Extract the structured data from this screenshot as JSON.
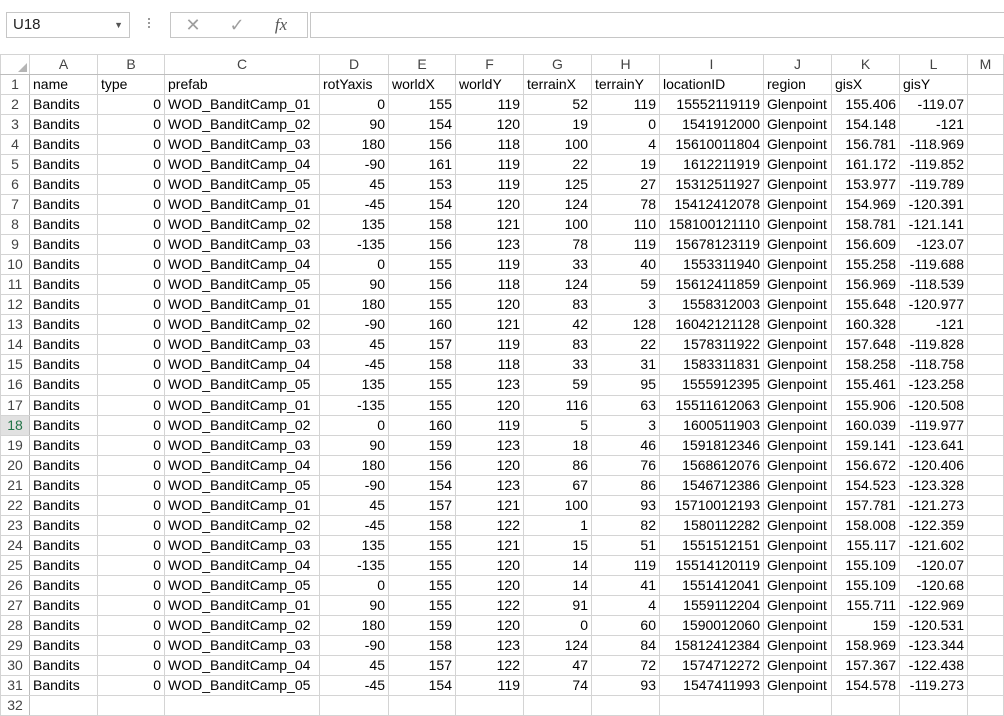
{
  "namebox": {
    "value": "U18"
  },
  "formula_bar": {
    "cancel_icon": "✕",
    "enter_icon": "✓",
    "fx_label": "fx",
    "value": ""
  },
  "columns": [
    "A",
    "B",
    "C",
    "D",
    "E",
    "F",
    "G",
    "H",
    "I",
    "J",
    "K",
    "L",
    "M"
  ],
  "headers": [
    "name",
    "type",
    "prefab",
    "rotYaxis",
    "worldX",
    "worldY",
    "terrainX",
    "terrainY",
    "locationID",
    "region",
    "gisX",
    "gisY"
  ],
  "rows": [
    [
      "Bandits",
      "0",
      "WOD_BanditCamp_01",
      "0",
      "155",
      "119",
      "52",
      "119",
      "15552119119",
      "Glenpoint",
      "155.406",
      "-119.07"
    ],
    [
      "Bandits",
      "0",
      "WOD_BanditCamp_02",
      "90",
      "154",
      "120",
      "19",
      "0",
      "1541912000",
      "Glenpoint",
      "154.148",
      "-121"
    ],
    [
      "Bandits",
      "0",
      "WOD_BanditCamp_03",
      "180",
      "156",
      "118",
      "100",
      "4",
      "15610011804",
      "Glenpoint",
      "156.781",
      "-118.969"
    ],
    [
      "Bandits",
      "0",
      "WOD_BanditCamp_04",
      "-90",
      "161",
      "119",
      "22",
      "19",
      "1612211919",
      "Glenpoint",
      "161.172",
      "-119.852"
    ],
    [
      "Bandits",
      "0",
      "WOD_BanditCamp_05",
      "45",
      "153",
      "119",
      "125",
      "27",
      "15312511927",
      "Glenpoint",
      "153.977",
      "-119.789"
    ],
    [
      "Bandits",
      "0",
      "WOD_BanditCamp_01",
      "-45",
      "154",
      "120",
      "124",
      "78",
      "15412412078",
      "Glenpoint",
      "154.969",
      "-120.391"
    ],
    [
      "Bandits",
      "0",
      "WOD_BanditCamp_02",
      "135",
      "158",
      "121",
      "100",
      "110",
      "158100121110",
      "Glenpoint",
      "158.781",
      "-121.141"
    ],
    [
      "Bandits",
      "0",
      "WOD_BanditCamp_03",
      "-135",
      "156",
      "123",
      "78",
      "119",
      "15678123119",
      "Glenpoint",
      "156.609",
      "-123.07"
    ],
    [
      "Bandits",
      "0",
      "WOD_BanditCamp_04",
      "0",
      "155",
      "119",
      "33",
      "40",
      "1553311940",
      "Glenpoint",
      "155.258",
      "-119.688"
    ],
    [
      "Bandits",
      "0",
      "WOD_BanditCamp_05",
      "90",
      "156",
      "118",
      "124",
      "59",
      "15612411859",
      "Glenpoint",
      "156.969",
      "-118.539"
    ],
    [
      "Bandits",
      "0",
      "WOD_BanditCamp_01",
      "180",
      "155",
      "120",
      "83",
      "3",
      "1558312003",
      "Glenpoint",
      "155.648",
      "-120.977"
    ],
    [
      "Bandits",
      "0",
      "WOD_BanditCamp_02",
      "-90",
      "160",
      "121",
      "42",
      "128",
      "16042121128",
      "Glenpoint",
      "160.328",
      "-121"
    ],
    [
      "Bandits",
      "0",
      "WOD_BanditCamp_03",
      "45",
      "157",
      "119",
      "83",
      "22",
      "1578311922",
      "Glenpoint",
      "157.648",
      "-119.828"
    ],
    [
      "Bandits",
      "0",
      "WOD_BanditCamp_04",
      "-45",
      "158",
      "118",
      "33",
      "31",
      "1583311831",
      "Glenpoint",
      "158.258",
      "-118.758"
    ],
    [
      "Bandits",
      "0",
      "WOD_BanditCamp_05",
      "135",
      "155",
      "123",
      "59",
      "95",
      "1555912395",
      "Glenpoint",
      "155.461",
      "-123.258"
    ],
    [
      "Bandits",
      "0",
      "WOD_BanditCamp_01",
      "-135",
      "155",
      "120",
      "116",
      "63",
      "15511612063",
      "Glenpoint",
      "155.906",
      "-120.508"
    ],
    [
      "Bandits",
      "0",
      "WOD_BanditCamp_02",
      "0",
      "160",
      "119",
      "5",
      "3",
      "1600511903",
      "Glenpoint",
      "160.039",
      "-119.977"
    ],
    [
      "Bandits",
      "0",
      "WOD_BanditCamp_03",
      "90",
      "159",
      "123",
      "18",
      "46",
      "1591812346",
      "Glenpoint",
      "159.141",
      "-123.641"
    ],
    [
      "Bandits",
      "0",
      "WOD_BanditCamp_04",
      "180",
      "156",
      "120",
      "86",
      "76",
      "1568612076",
      "Glenpoint",
      "156.672",
      "-120.406"
    ],
    [
      "Bandits",
      "0",
      "WOD_BanditCamp_05",
      "-90",
      "154",
      "123",
      "67",
      "86",
      "1546712386",
      "Glenpoint",
      "154.523",
      "-123.328"
    ],
    [
      "Bandits",
      "0",
      "WOD_BanditCamp_01",
      "45",
      "157",
      "121",
      "100",
      "93",
      "15710012193",
      "Glenpoint",
      "157.781",
      "-121.273"
    ],
    [
      "Bandits",
      "0",
      "WOD_BanditCamp_02",
      "-45",
      "158",
      "122",
      "1",
      "82",
      "1580112282",
      "Glenpoint",
      "158.008",
      "-122.359"
    ],
    [
      "Bandits",
      "0",
      "WOD_BanditCamp_03",
      "135",
      "155",
      "121",
      "15",
      "51",
      "1551512151",
      "Glenpoint",
      "155.117",
      "-121.602"
    ],
    [
      "Bandits",
      "0",
      "WOD_BanditCamp_04",
      "-135",
      "155",
      "120",
      "14",
      "119",
      "15514120119",
      "Glenpoint",
      "155.109",
      "-120.07"
    ],
    [
      "Bandits",
      "0",
      "WOD_BanditCamp_05",
      "0",
      "155",
      "120",
      "14",
      "41",
      "1551412041",
      "Glenpoint",
      "155.109",
      "-120.68"
    ],
    [
      "Bandits",
      "0",
      "WOD_BanditCamp_01",
      "90",
      "155",
      "122",
      "91",
      "4",
      "1559112204",
      "Glenpoint",
      "155.711",
      "-122.969"
    ],
    [
      "Bandits",
      "0",
      "WOD_BanditCamp_02",
      "180",
      "159",
      "120",
      "0",
      "60",
      "1590012060",
      "Glenpoint",
      "159",
      "-120.531"
    ],
    [
      "Bandits",
      "0",
      "WOD_BanditCamp_03",
      "-90",
      "158",
      "123",
      "124",
      "84",
      "15812412384",
      "Glenpoint",
      "158.969",
      "-123.344"
    ],
    [
      "Bandits",
      "0",
      "WOD_BanditCamp_04",
      "45",
      "157",
      "122",
      "47",
      "72",
      "1574712272",
      "Glenpoint",
      "157.367",
      "-122.438"
    ],
    [
      "Bandits",
      "0",
      "WOD_BanditCamp_05",
      "-45",
      "154",
      "119",
      "74",
      "93",
      "1547411993",
      "Glenpoint",
      "154.578",
      "-119.273"
    ]
  ],
  "numeric_columns": [
    1,
    3,
    4,
    5,
    6,
    7,
    8,
    10,
    11
  ],
  "active_row": 18,
  "row_count": 32
}
